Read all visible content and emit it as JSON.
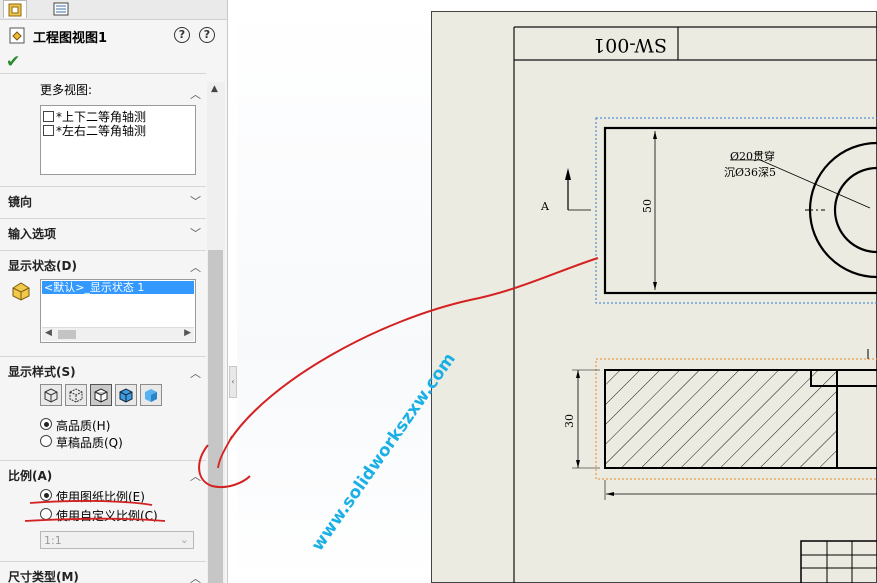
{
  "property_manager": {
    "title": "工程图视图1",
    "help_glyph": "?",
    "more_views": {
      "label": "更多视图:",
      "items": [
        "*上下二等角轴测",
        "*左右二等角轴测"
      ]
    },
    "sections": {
      "mirror": "镜向",
      "import_options": "输入选项",
      "display_state": "显示状态(D)",
      "display_style": "显示样式(S)",
      "scale": "比例(A)",
      "dimension_type": "尺寸类型(M)"
    },
    "display_state_item": "<默认>_显示状态 1",
    "quality": {
      "high": "高品质(H)",
      "draft": "草稿品质(Q)"
    },
    "scale_options": {
      "sheet_scale": "使用图纸比例(E)",
      "custom_scale": "使用自定义比例(C)",
      "custom_value": "1:1"
    }
  },
  "drawing": {
    "title_block": "SW-001",
    "section_label": "A",
    "hole_note_line1": "Ø20贯穿",
    "hole_note_line2": "沉Ø36深5",
    "dim_50": "50",
    "dim_30": "30"
  },
  "watermark": "www.solidworkszxw.com",
  "colors": {
    "annotation_red": "#d42222",
    "watermark_cyan": "#1ab0e6",
    "selection_blue": "#2f7fd0",
    "selection_orange": "#e88a2a",
    "sheet_bg": "#ecebe1"
  }
}
